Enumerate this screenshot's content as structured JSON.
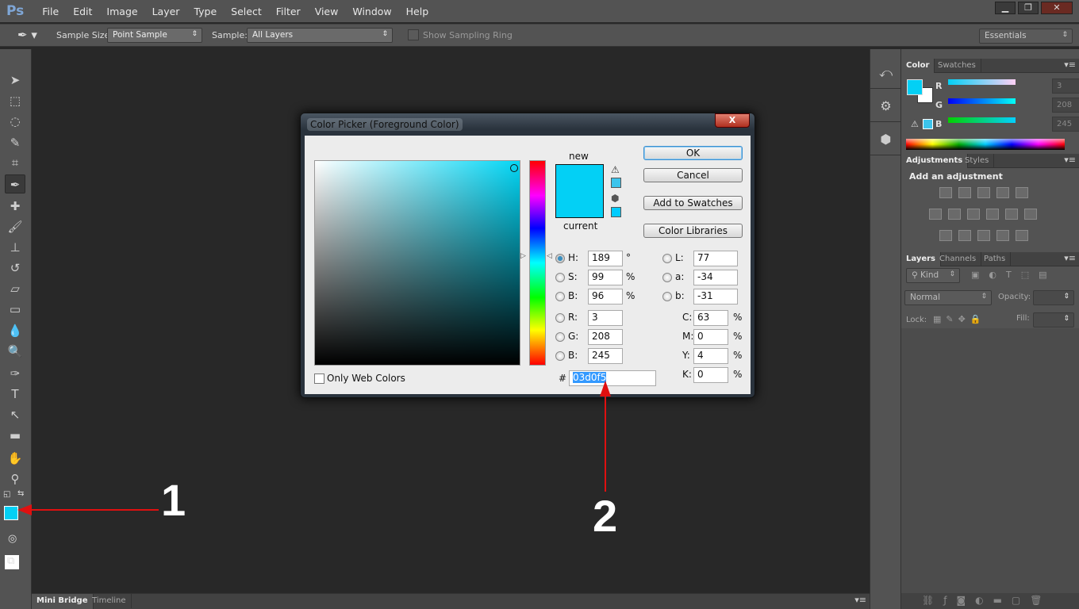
{
  "app": {
    "logo": "Ps",
    "menu": [
      "File",
      "Edit",
      "Image",
      "Layer",
      "Type",
      "Select",
      "Filter",
      "View",
      "Window",
      "Help"
    ],
    "window_buttons": [
      "minimize",
      "restore",
      "close"
    ]
  },
  "options": {
    "sample_size_label": "Sample Size:",
    "sample_size_value": "Point Sample",
    "sample_label": "Sample:",
    "sample_value": "All Layers",
    "sampling_ring_label": "Show Sampling Ring",
    "sampling_ring_checked": false,
    "workspace": "Essentials"
  },
  "tools": [
    {
      "name": "move-tool",
      "glyph": "➤"
    },
    {
      "name": "marquee-tool",
      "glyph": "⬚"
    },
    {
      "name": "lasso-tool",
      "glyph": "◌"
    },
    {
      "name": "quick-selection-tool",
      "glyph": "✎"
    },
    {
      "name": "crop-tool",
      "glyph": "⌗"
    },
    {
      "name": "eyedropper-tool",
      "glyph": "✒",
      "active": true
    },
    {
      "name": "healing-brush-tool",
      "glyph": "✚"
    },
    {
      "name": "brush-tool",
      "glyph": "🖌"
    },
    {
      "name": "clone-stamp-tool",
      "glyph": "⊥"
    },
    {
      "name": "history-brush-tool",
      "glyph": "↺"
    },
    {
      "name": "eraser-tool",
      "glyph": "▱"
    },
    {
      "name": "gradient-tool",
      "glyph": "▭"
    },
    {
      "name": "blur-tool",
      "glyph": "💧"
    },
    {
      "name": "dodge-tool",
      "glyph": "🔍"
    },
    {
      "name": "pen-tool",
      "glyph": "✑"
    },
    {
      "name": "type-tool",
      "glyph": "T"
    },
    {
      "name": "path-selection-tool",
      "glyph": "↖"
    },
    {
      "name": "rectangle-tool",
      "glyph": "▬"
    },
    {
      "name": "hand-tool",
      "glyph": "✋"
    },
    {
      "name": "zoom-tool",
      "glyph": "⚲"
    }
  ],
  "colors": {
    "foreground": "#03d0f5",
    "background": "#ffffff",
    "accent": "#03d0f5"
  },
  "color_panel": {
    "tabs": [
      "Color",
      "Swatches"
    ],
    "r_label": "R",
    "g_label": "G",
    "b_label": "B",
    "r": "3",
    "g": "208",
    "b": "245"
  },
  "adjustments_panel": {
    "tabs": [
      "Adjustments",
      "Styles"
    ],
    "heading": "Add an adjustment"
  },
  "layers_panel": {
    "tabs": [
      "Layers",
      "Channels",
      "Paths"
    ],
    "filter": "Kind",
    "blend_mode": "Normal",
    "opacity_label": "Opacity:",
    "lock_label": "Lock:",
    "fill_label": "Fill:"
  },
  "bottom_tabs": [
    "Mini Bridge",
    "Timeline"
  ],
  "dialog": {
    "title": "Color Picker (Foreground Color)",
    "close": "X",
    "new_label": "new",
    "current_label": "current",
    "ok": "OK",
    "cancel": "Cancel",
    "add_swatches": "Add to Swatches",
    "libraries": "Color Libraries",
    "only_web_colors": "Only Web Colors",
    "only_web_checked": false,
    "H": "189",
    "S": "99",
    "Bv": "96",
    "R": "3",
    "G": "208",
    "B": "245",
    "L": "77",
    "a": "-34",
    "b": "-31",
    "C": "63",
    "M": "0",
    "Y": "4",
    "K": "0",
    "hex": "03d0f5",
    "labels": {
      "H": "H:",
      "S": "S:",
      "Bv": "B:",
      "R": "R:",
      "G": "G:",
      "B": "B:",
      "L": "L:",
      "a": "a:",
      "b": "b:",
      "C": "C:",
      "M": "M:",
      "Y": "Y:",
      "K": "K:",
      "hash": "#",
      "deg": "°",
      "pct": "%"
    },
    "selected_mode": "H"
  },
  "annotations": [
    "1",
    "2"
  ],
  "annotation_color": "#e01010"
}
